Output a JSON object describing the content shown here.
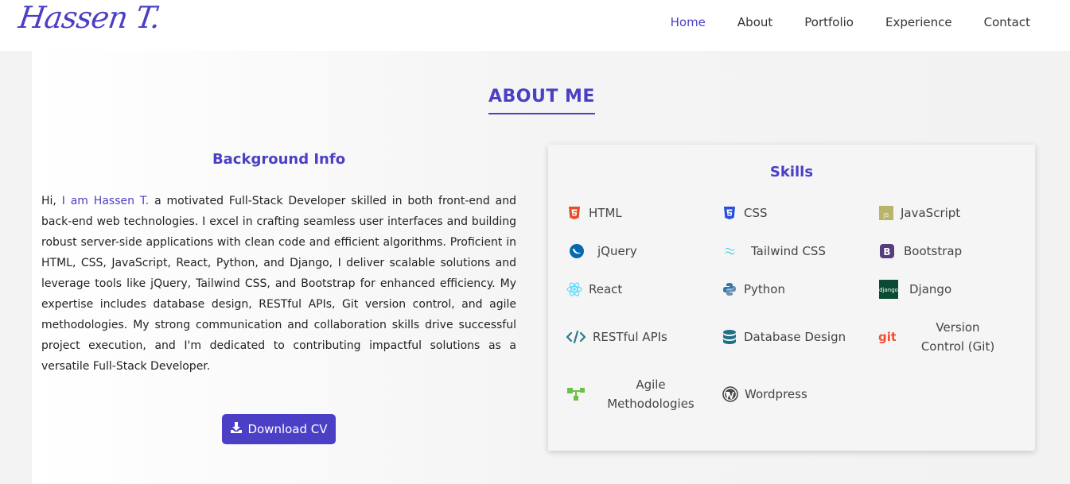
{
  "brand": {
    "logo": "Hassen T."
  },
  "nav": {
    "items": [
      "Home",
      "About",
      "Portfolio",
      "Experience",
      "Contact"
    ],
    "active": "Home"
  },
  "about": {
    "title": "ABOUT ME",
    "background": {
      "title": "Background Info",
      "intro": "Hi, ",
      "highlight": "I am Hassen T.",
      "text": " a motivated Full-Stack Developer skilled in both front-end and back-end web technologies. I excel in crafting seamless user interfaces and building robust server-side applications with clean code and efficient algorithms. Proficient in HTML, CSS, JavaScript, React, Python, and Django, I deliver scalable solutions and leverage tools like jQuery, Tailwind CSS, and Bootstrap for enhanced efficiency. My expertise includes database design, RESTful APIs, Git version control, and agile methodologies. My strong communication and collaboration skills drive successful project execution, and I'm dedicated to contributing impactful solutions as a versatile Full-Stack Developer."
    },
    "download_label": "Download CV",
    "skills": {
      "title": "Skills",
      "items": [
        {
          "label": "HTML",
          "icon": "html5-icon"
        },
        {
          "label": "CSS",
          "icon": "css3-icon"
        },
        {
          "label": "JavaScript",
          "icon": "javascript-icon"
        },
        {
          "label": "jQuery",
          "icon": "jquery-icon"
        },
        {
          "label": "Tailwind CSS",
          "icon": "tailwind-icon"
        },
        {
          "label": "Bootstrap",
          "icon": "bootstrap-icon"
        },
        {
          "label": "React",
          "icon": "react-icon"
        },
        {
          "label": "Python",
          "icon": "python-icon"
        },
        {
          "label": "Django",
          "icon": "django-icon"
        },
        {
          "label": "RESTful APIs",
          "icon": "code-icon"
        },
        {
          "label": "Database Design",
          "icon": "database-icon"
        },
        {
          "label": "Version Control (Git)",
          "icon": "git-icon"
        },
        {
          "label": "Agile Methodologies",
          "icon": "agile-icon"
        },
        {
          "label": "Wordpress",
          "icon": "wordpress-icon"
        }
      ]
    }
  },
  "colors": {
    "accent": "#4b3fc6"
  }
}
